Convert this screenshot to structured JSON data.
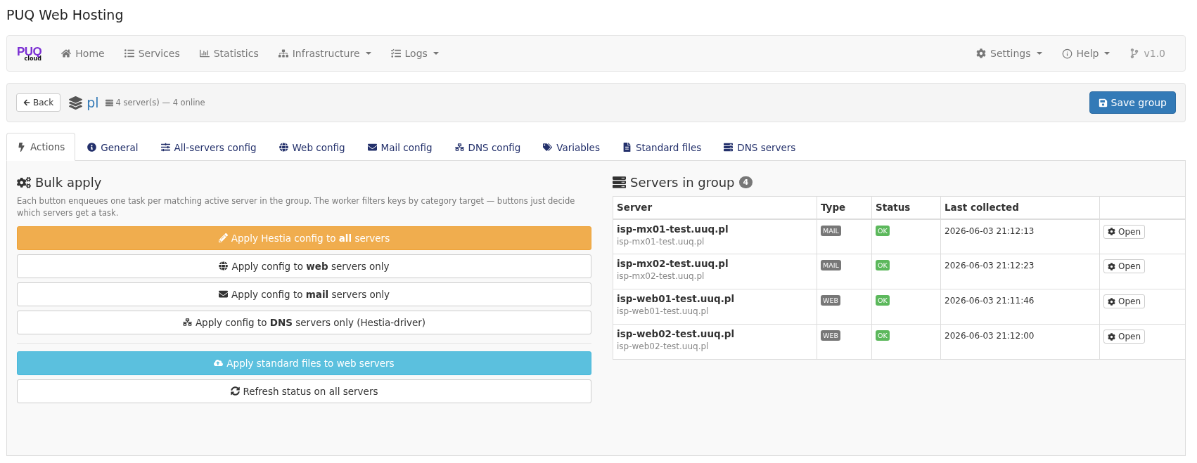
{
  "app_title": "PUQ Web Hosting",
  "navbar": {
    "logo": {
      "main": "PUQ",
      "sub": "cloud"
    },
    "items": [
      {
        "label": "Home",
        "dropdown": false
      },
      {
        "label": "Services",
        "dropdown": false
      },
      {
        "label": "Statistics",
        "dropdown": false
      },
      {
        "label": "Infrastructure",
        "dropdown": true
      },
      {
        "label": "Logs",
        "dropdown": true
      }
    ],
    "right_items": [
      {
        "label": "Settings",
        "dropdown": true
      },
      {
        "label": "Help",
        "dropdown": true
      },
      {
        "label": "v1.0",
        "dropdown": false
      }
    ]
  },
  "group_header": {
    "back": "Back",
    "name": "pl",
    "summary": "4 server(s) — 4 online",
    "save": "Save group"
  },
  "tabs": [
    {
      "label": "Actions",
      "selected": true
    },
    {
      "label": "General",
      "selected": false
    },
    {
      "label": "All-servers config",
      "selected": false
    },
    {
      "label": "Web config",
      "selected": false
    },
    {
      "label": "Mail config",
      "selected": false
    },
    {
      "label": "DNS config",
      "selected": false
    },
    {
      "label": "Variables",
      "selected": false
    },
    {
      "label": "Standard files",
      "selected": false
    },
    {
      "label": "DNS servers",
      "selected": false
    }
  ],
  "bulk_apply": {
    "title": "Bulk apply",
    "description": "Each button enqueues one task per matching active server in the group. The worker filters keys by category target — buttons just decide which servers get a task.",
    "button_groups": [
      [
        {
          "label": "Apply Hestia config to **all** servers",
          "kind": "warning"
        },
        {
          "label": "Apply config to **web** servers only",
          "kind": "default"
        },
        {
          "label": "Apply config to **mail** servers only",
          "kind": "default"
        },
        {
          "label": "Apply config to **DNS** servers only (Hestia-driver)",
          "kind": "default"
        }
      ],
      [
        {
          "label": "Apply standard files to web servers",
          "kind": "info"
        },
        {
          "label": "Refresh status on all servers",
          "kind": "default"
        }
      ]
    ]
  },
  "servers": {
    "title": "Servers in group",
    "count": "4",
    "columns": [
      "Server",
      "Type",
      "Status",
      "Last collected"
    ],
    "rows": [
      {
        "name": "isp-mx01-test.uuq.pl",
        "host": "isp-mx01-test.uuq.pl",
        "type": "MAIL",
        "status": {
          "label": "OK",
          "color": "#5cb85c"
        },
        "last_collected": "2026-06-03 21:12:13",
        "action": "Open"
      },
      {
        "name": "isp-mx02-test.uuq.pl",
        "host": "isp-mx02-test.uuq.pl",
        "type": "MAIL",
        "status": {
          "label": "OK",
          "color": "#5cb85c"
        },
        "last_collected": "2026-06-03 21:12:23",
        "action": "Open"
      },
      {
        "name": "isp-web01-test.uuq.pl",
        "host": "isp-web01-test.uuq.pl",
        "type": "WEB",
        "status": {
          "label": "OK",
          "color": "#5cb85c"
        },
        "last_collected": "2026-06-03 21:11:46",
        "action": "Open"
      },
      {
        "name": "isp-web02-test.uuq.pl",
        "host": "isp-web02-test.uuq.pl",
        "type": "WEB",
        "status": {
          "label": "OK",
          "color": "#5cb85c"
        },
        "last_collected": "2026-06-03 21:12:00",
        "action": "Open"
      }
    ]
  }
}
